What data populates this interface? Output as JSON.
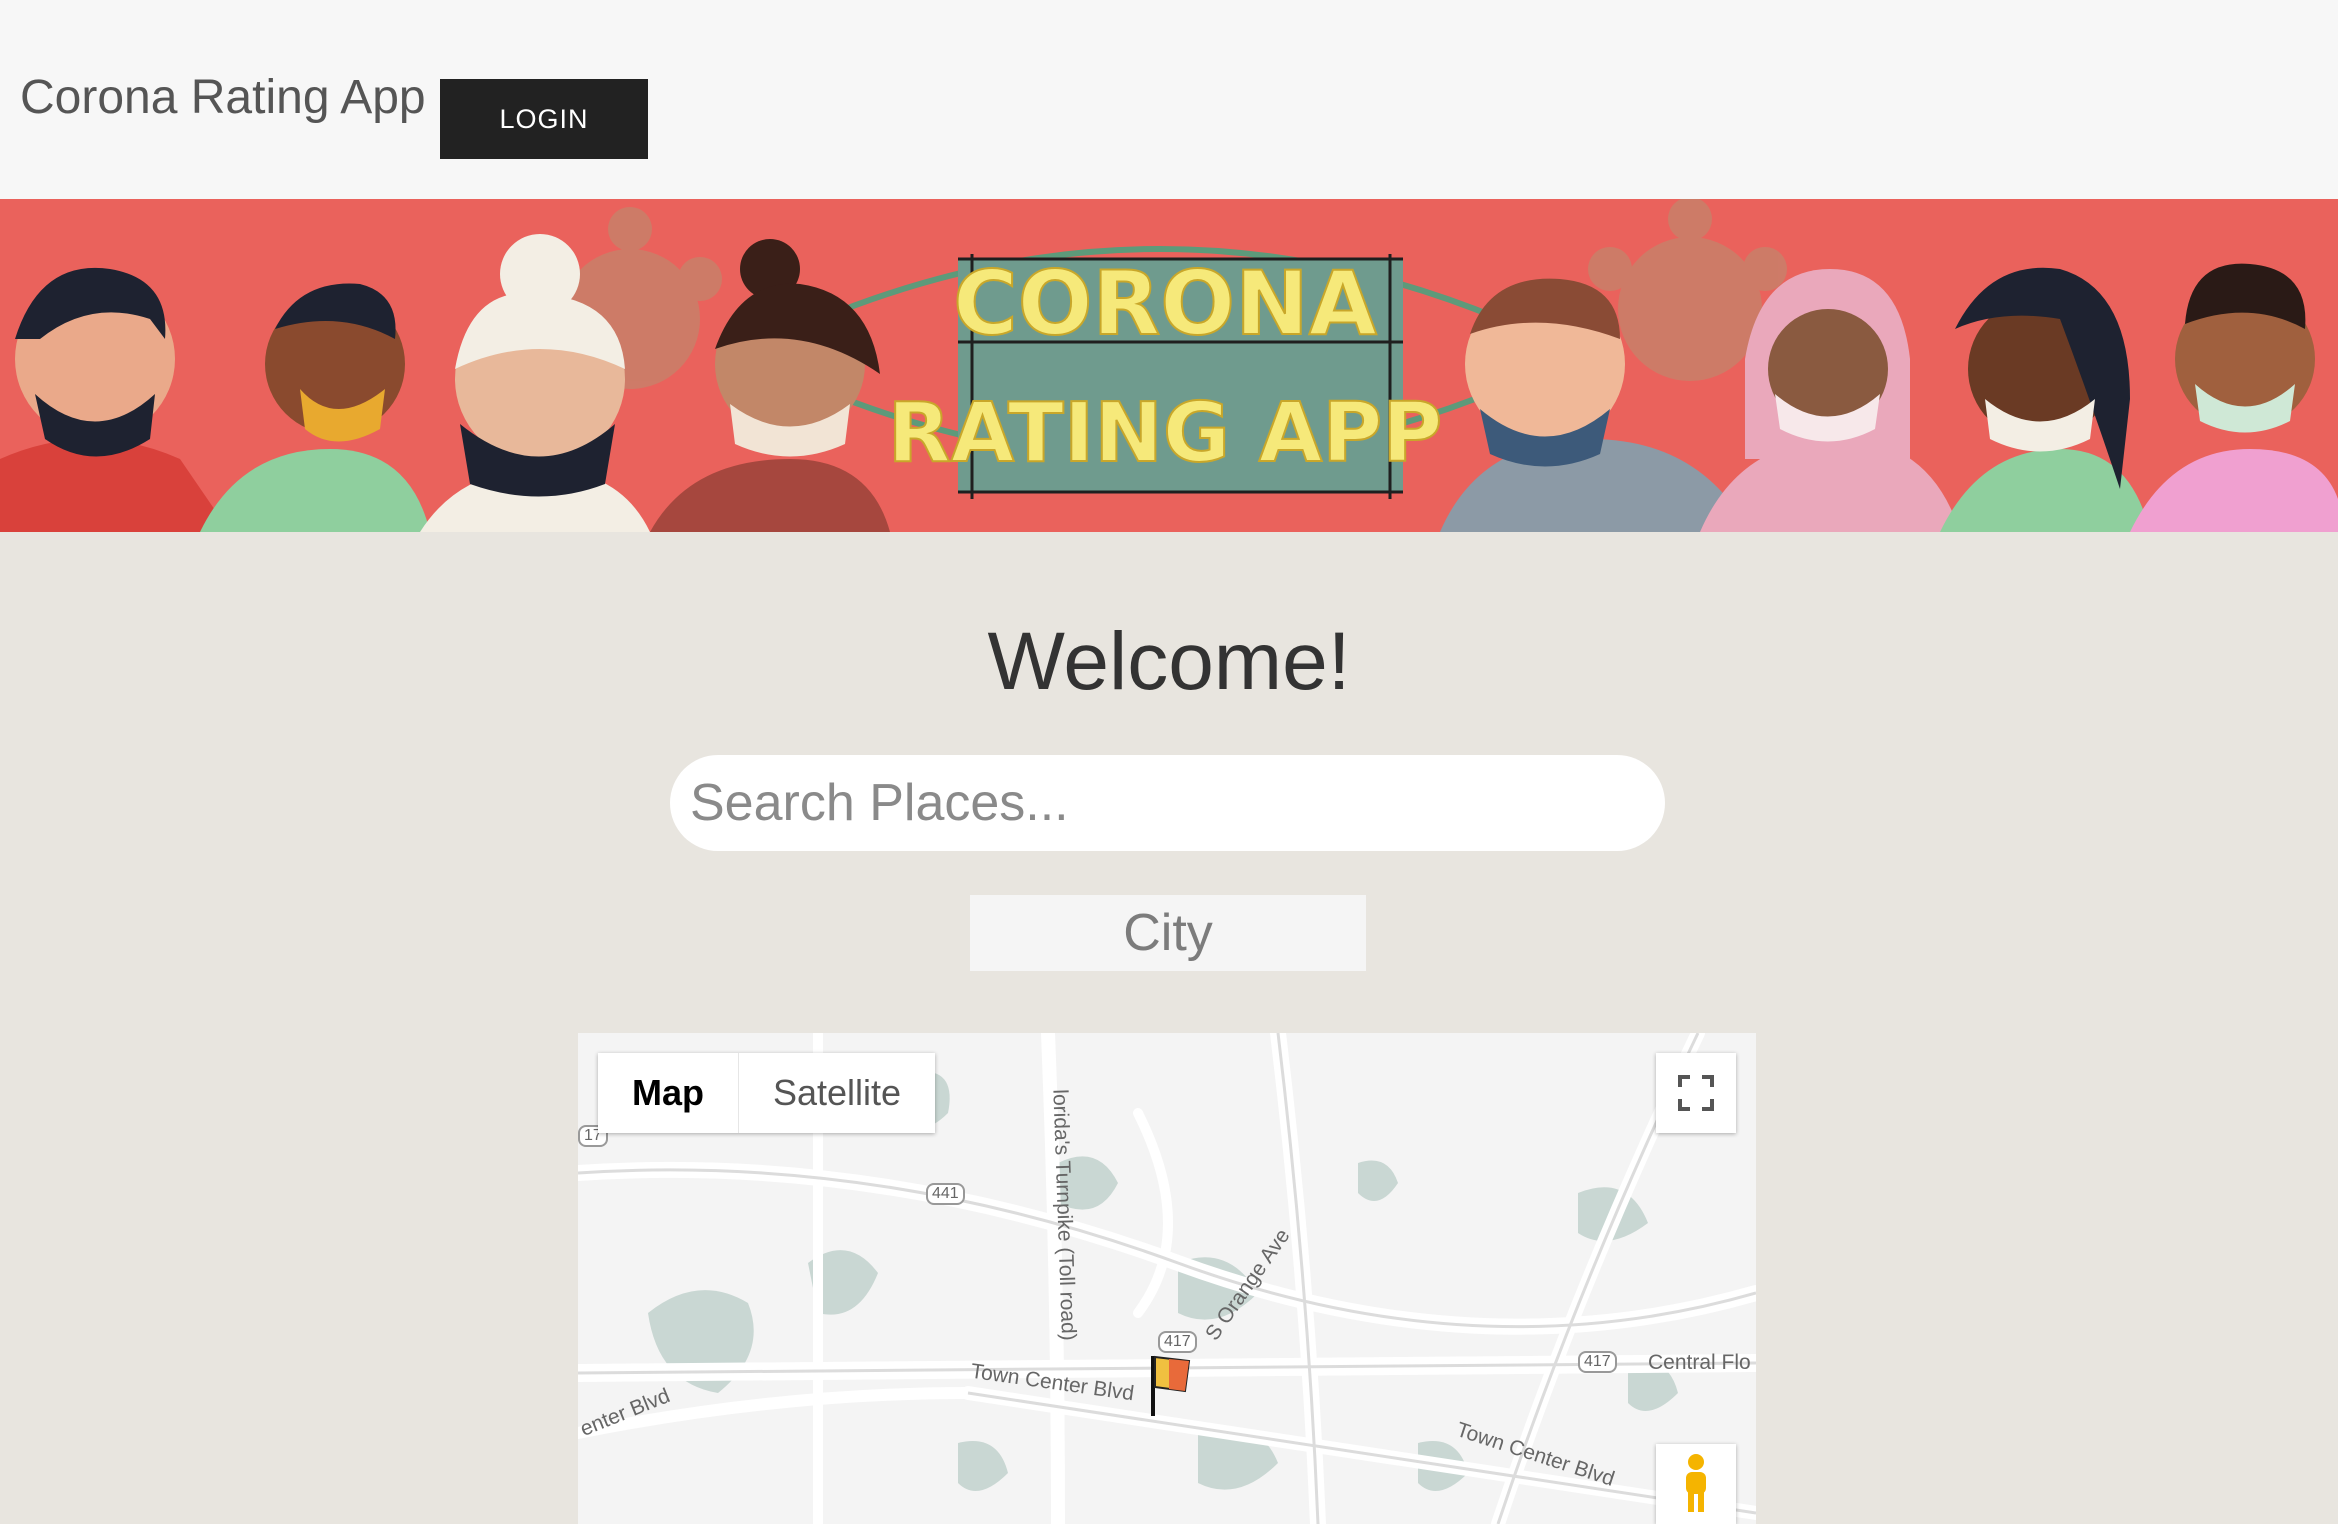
{
  "navbar": {
    "brand": "Corona Rating App",
    "login_label": "LOGIN"
  },
  "banner": {
    "line1": "CORONA",
    "line2": "RATING APP"
  },
  "main": {
    "welcome": "Welcome!",
    "search_placeholder": "Search Places...",
    "city_label": "City"
  },
  "map": {
    "type_map": "Map",
    "type_satellite": "Satellite",
    "labels": {
      "turnpike": "lorida's Turnpike (Toll road)",
      "orange_ave": "S Orange Ave",
      "central_fl": "Central Flo",
      "town_center_1": "Town Center Blvd",
      "town_center_2": "Town Center Blvd",
      "center_blvd": "enter Blvd",
      "route_441": "441",
      "route_417a": "417",
      "route_417b": "417",
      "route_17": "17"
    },
    "icons": {
      "fullscreen": "fullscreen-icon",
      "pegman": "pegman-icon",
      "marker": "flag-marker-icon"
    }
  },
  "colors": {
    "banner_bg": "#ea625c",
    "page_bg": "#e8e5df",
    "navbar_bg": "#f7f7f7",
    "login_bg": "#222222"
  }
}
